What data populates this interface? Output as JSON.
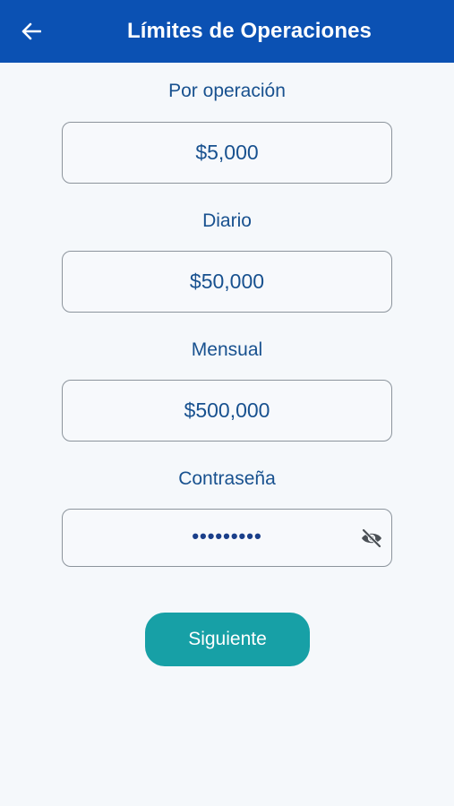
{
  "header": {
    "title": "Límites de Operaciones",
    "back_icon": "arrow-left-icon"
  },
  "fields": {
    "per_operation": {
      "label": "Por operación",
      "value": "$5,000"
    },
    "daily": {
      "label": "Diario",
      "value": "$50,000"
    },
    "monthly": {
      "label": "Mensual",
      "value": "$500,000"
    },
    "password": {
      "label": "Contraseña",
      "value": "•••••••••",
      "toggle_icon": "eye-off-icon"
    }
  },
  "actions": {
    "next_label": "Siguiente"
  },
  "colors": {
    "header_bg": "#0b51b3",
    "text_blue": "#18518f",
    "button_teal": "#17a0a6",
    "border_gray": "#8c949c",
    "background": "#f5f8fb"
  }
}
